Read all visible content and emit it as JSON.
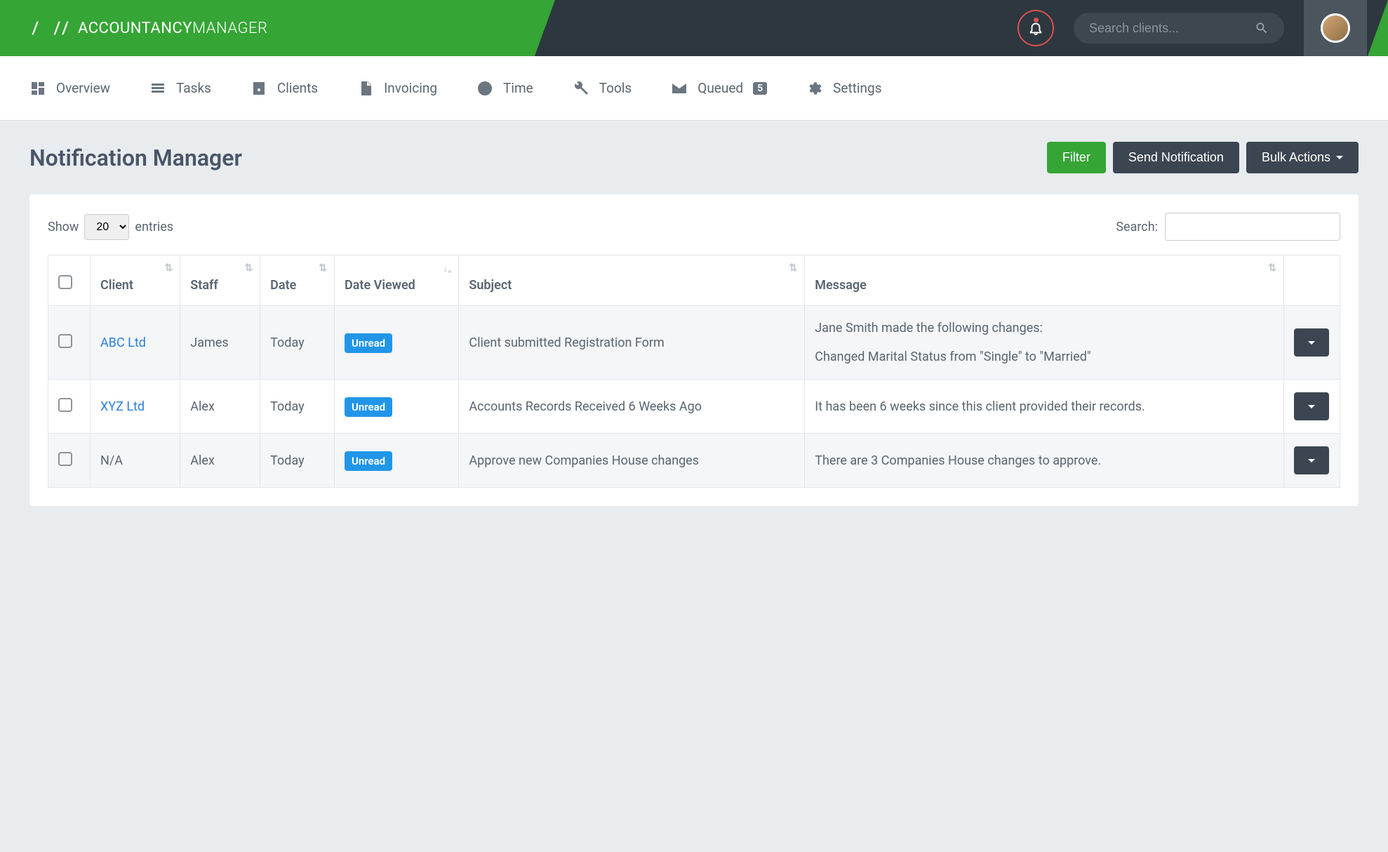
{
  "brand": {
    "name_bold": "ACCOUNTANCY",
    "name_light": "MANAGER"
  },
  "search": {
    "placeholder": "Search clients..."
  },
  "nav": {
    "overview": "Overview",
    "tasks": "Tasks",
    "clients": "Clients",
    "invoicing": "Invoicing",
    "time": "Time",
    "tools": "Tools",
    "queued": "Queued",
    "queued_count": "5",
    "settings": "Settings"
  },
  "page": {
    "title": "Notification Manager"
  },
  "buttons": {
    "filter": "Filter",
    "send": "Send Notification",
    "bulk": "Bulk Actions"
  },
  "table": {
    "show_prefix": "Show",
    "show_value": "20",
    "show_suffix": "entries",
    "search_label": "Search:",
    "cols": {
      "client": "Client",
      "staff": "Staff",
      "date": "Date",
      "date_viewed": "Date Viewed",
      "subject": "Subject",
      "message": "Message"
    },
    "badge_unread": "Unread",
    "rows": [
      {
        "client": "ABC Ltd",
        "client_link": true,
        "staff": "James",
        "date": "Today",
        "viewed": "Unread",
        "subject": "Client submitted Registration Form",
        "message1": "Jane Smith made the following changes:",
        "message2": "Changed Marital Status from \"Single\" to \"Married\""
      },
      {
        "client": "XYZ Ltd",
        "client_link": true,
        "staff": "Alex",
        "date": "Today",
        "viewed": "Unread",
        "subject": "Accounts Records Received 6 Weeks Ago",
        "message1": "It has been 6 weeks since this client provided their records.",
        "message2": ""
      },
      {
        "client": "N/A",
        "client_link": false,
        "staff": "Alex",
        "date": "Today",
        "viewed": "Unread",
        "subject": "Approve new Companies House changes",
        "message1": "There are 3 Companies House changes to approve.",
        "message2": ""
      }
    ]
  }
}
